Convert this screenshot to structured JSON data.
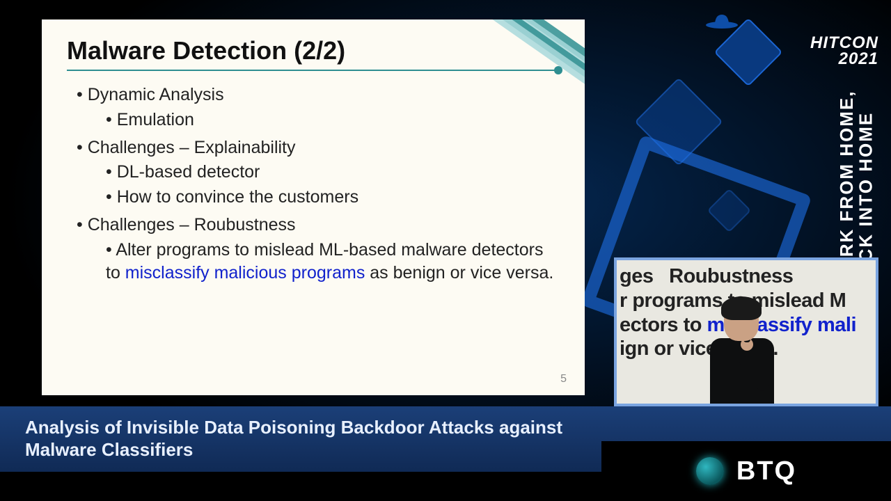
{
  "slide": {
    "title": "Malware Detection (2/2)",
    "page_number": "5",
    "bullets": {
      "b1": "Dynamic Analysis",
      "b1a": "Emulation",
      "b2": "Challenges – Explainability",
      "b2a": "DL-based detector",
      "b2b": "How to convince the customers",
      "b3": "Challenges – Roubustness",
      "b3a_pre": "Alter programs to mislead ML-based malware detectors to ",
      "b3a_hl": "misclassify malicious programs",
      "b3a_post": " as benign or vice versa."
    }
  },
  "caption": {
    "title": "Analysis of Invisible Data Poisoning Backdoor Attacks against Malware Classifiers"
  },
  "conference": {
    "name_line1": "HITCON",
    "name_line2": "2021",
    "tagline_line1": "WORK FROM HOME,",
    "tagline_line2": "HACK INTO HOME"
  },
  "pip": {
    "line1": "ges   Roubustness",
    "line2_pre": "r programs to mislead M",
    "line3_pre": "ectors to ",
    "line3_hl": "misclassify mali",
    "line4": "ign or vice versa."
  },
  "sponsor": {
    "name": "BTQ"
  }
}
